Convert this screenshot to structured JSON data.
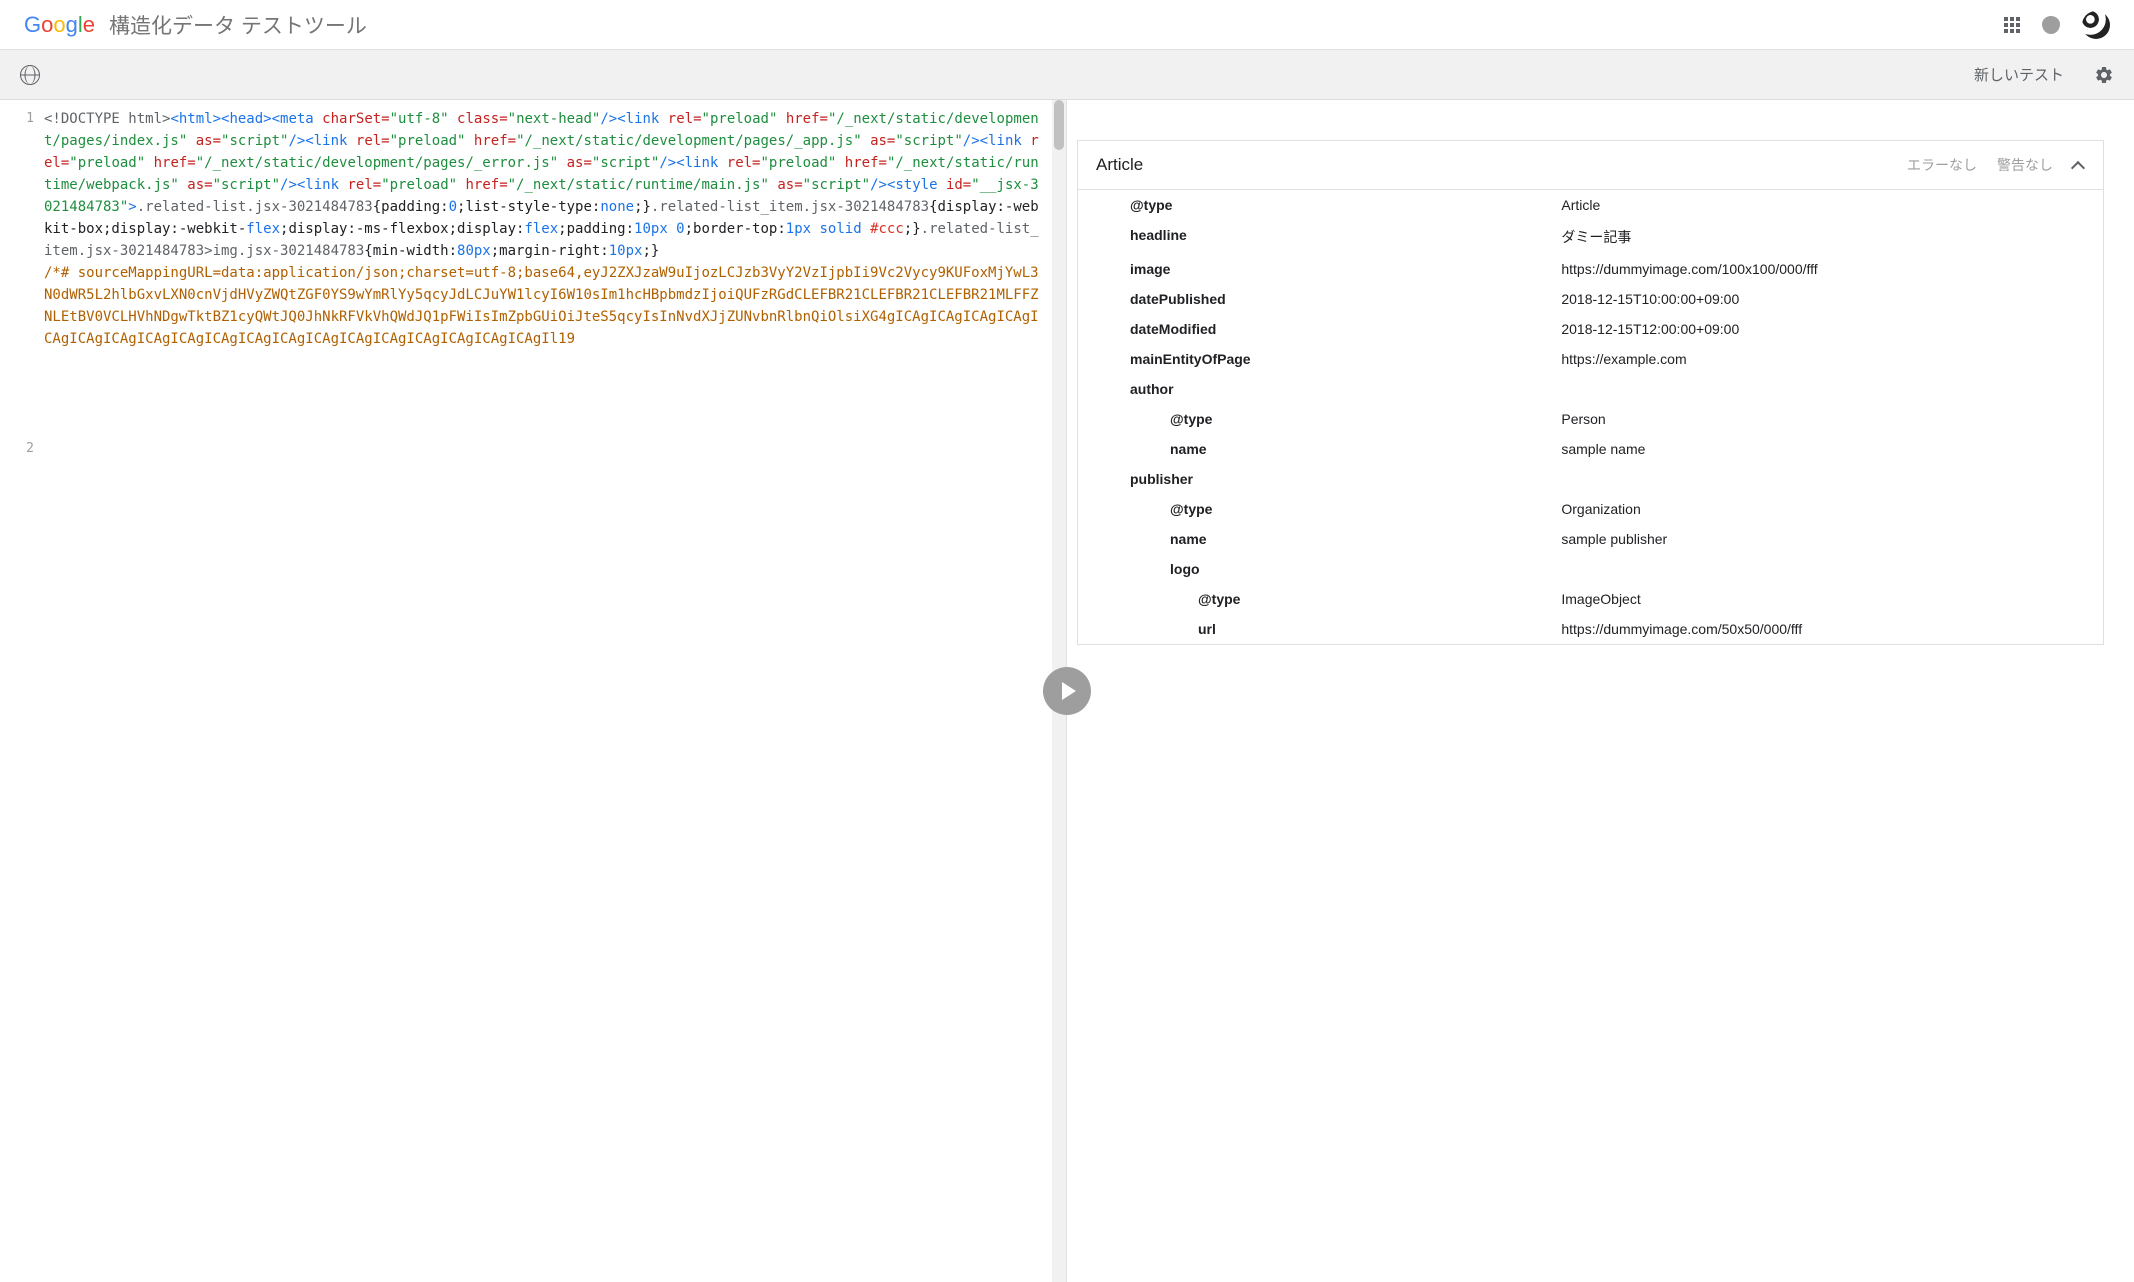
{
  "header": {
    "app_title": "構造化データ テストツール"
  },
  "toolbar": {
    "new_test_label": "新しいテスト"
  },
  "code": {
    "line1_num": "1",
    "line2_num": "2",
    "doctype": "<!DOCTYPE html>",
    "html_open": "<html>",
    "head_open": "<head>",
    "meta_open": "<meta",
    "charset_attr": " charSet=",
    "charset_val": "\"utf-8\"",
    "class_attr": " class=",
    "nexthead_val": "\"next-head\"",
    "selfclose": "/>",
    "link_open": "<link",
    "rel_attr": " rel=",
    "preload_val": "\"preload\"",
    "href_attr": " href=",
    "href1_val": "\"/_next/static/development/pages/index.js\"",
    "href2_val": "\"/_next/static/development/pages/_app.js\"",
    "href3_val": "\"/_next/static/development/pages/_error.js\"",
    "href4_val": "\"/_next/static/runtime/webpack.js\"",
    "href5_val": "\"/_next/static/runtime/main.js\"",
    "as_attr": " as=",
    "script_val": "\"script\"",
    "style_open": "<style",
    "id_attr": " id=",
    "styleid_val": "\"__jsx-3021484783\"",
    "gt": ">",
    "sel1": ".related-list.jsx-3021484783",
    "rule1a": "{padding:",
    "zero": "0",
    "rule1b": ";list-style-type:",
    "none": "none",
    "rule1c": ";}",
    "sel2": ".related-list_item.jsx-3021484783",
    "rule2a": "{display:-webkit-box;display:-webkit-",
    "flex": "flex",
    "rule2b": ";display:-ms-flexbox;display:",
    "rule2c": ";padding:",
    "tenpx0": "10px 0",
    "rule2d": ";border-top:",
    "onepxsolid": "1px solid ",
    "ccc": "#ccc",
    "rule2e": ";}",
    "sel3": ".related-list_item.jsx-3021484783>img.jsx-3021484783",
    "rule3a": "{min-width:",
    "eightypx": "80px",
    "rule3b": ";margin-right:",
    "tenpx": "10px",
    "rule3c": ";}",
    "comment_block": "/*# sourceMappingURL=data:application/json;charset=utf-8;base64,eyJ2ZXJzaW9uIjozLCJzb3VyY2VzIjpbIi9Vc2Vycy9KUFoxMjYwL3N0dWR5L2hlbGxvLXN0cnVjdHVyZWQtZGF0YS9wYmRlYy5qcyJdLCJuYW1lcyI6W10sIm1hcHBpbmdzIjoiQUFzRGdCLEFBR21CLEFBR21CLEFBR21MLFFZNLEtBV0VCLHVhNDgwTktBZ1cyQWtJQ0JhNkRFVkVhQWdJQ1pFWiIsImZpbGUiOiJteS5qcyIsInNvdXJjZUNvbnRlbnQiOlsiXG4gICAgICAgICAgICAgICAgICAgICAgICAgICAgICAgICAgICAgICAgICAgICAgICAgICAgICAgICAgIl19"
  },
  "result": {
    "title": "Article",
    "errors_label": "エラーなし",
    "warnings_label": "警告なし",
    "props": [
      {
        "key": "@type",
        "val": "Article",
        "nested": false
      },
      {
        "key": "headline",
        "val": "ダミー記事",
        "nested": false
      },
      {
        "key": "image",
        "val": "https://dummyimage.com/100x100/000/fff",
        "nested": false
      },
      {
        "key": "datePublished",
        "val": "2018-12-15T10:00:00+09:00",
        "nested": false
      },
      {
        "key": "dateModified",
        "val": "2018-12-15T12:00:00+09:00",
        "nested": false
      },
      {
        "key": "mainEntityOfPage",
        "val": "https://example.com",
        "nested": false
      },
      {
        "key": "author",
        "val": "",
        "nested": false
      },
      {
        "key": "@type",
        "val": "Person",
        "nested": true
      },
      {
        "key": "name",
        "val": "sample name",
        "nested": true
      },
      {
        "key": "publisher",
        "val": "",
        "nested": false
      },
      {
        "key": "@type",
        "val": "Organization",
        "nested": true
      },
      {
        "key": "name",
        "val": "sample publisher",
        "nested": true
      },
      {
        "key": "logo",
        "val": "",
        "nested": true
      },
      {
        "key": "@type",
        "val": "ImageObject",
        "nested": "double"
      },
      {
        "key": "url",
        "val": "https://dummyimage.com/50x50/000/fff",
        "nested": "double"
      }
    ]
  }
}
